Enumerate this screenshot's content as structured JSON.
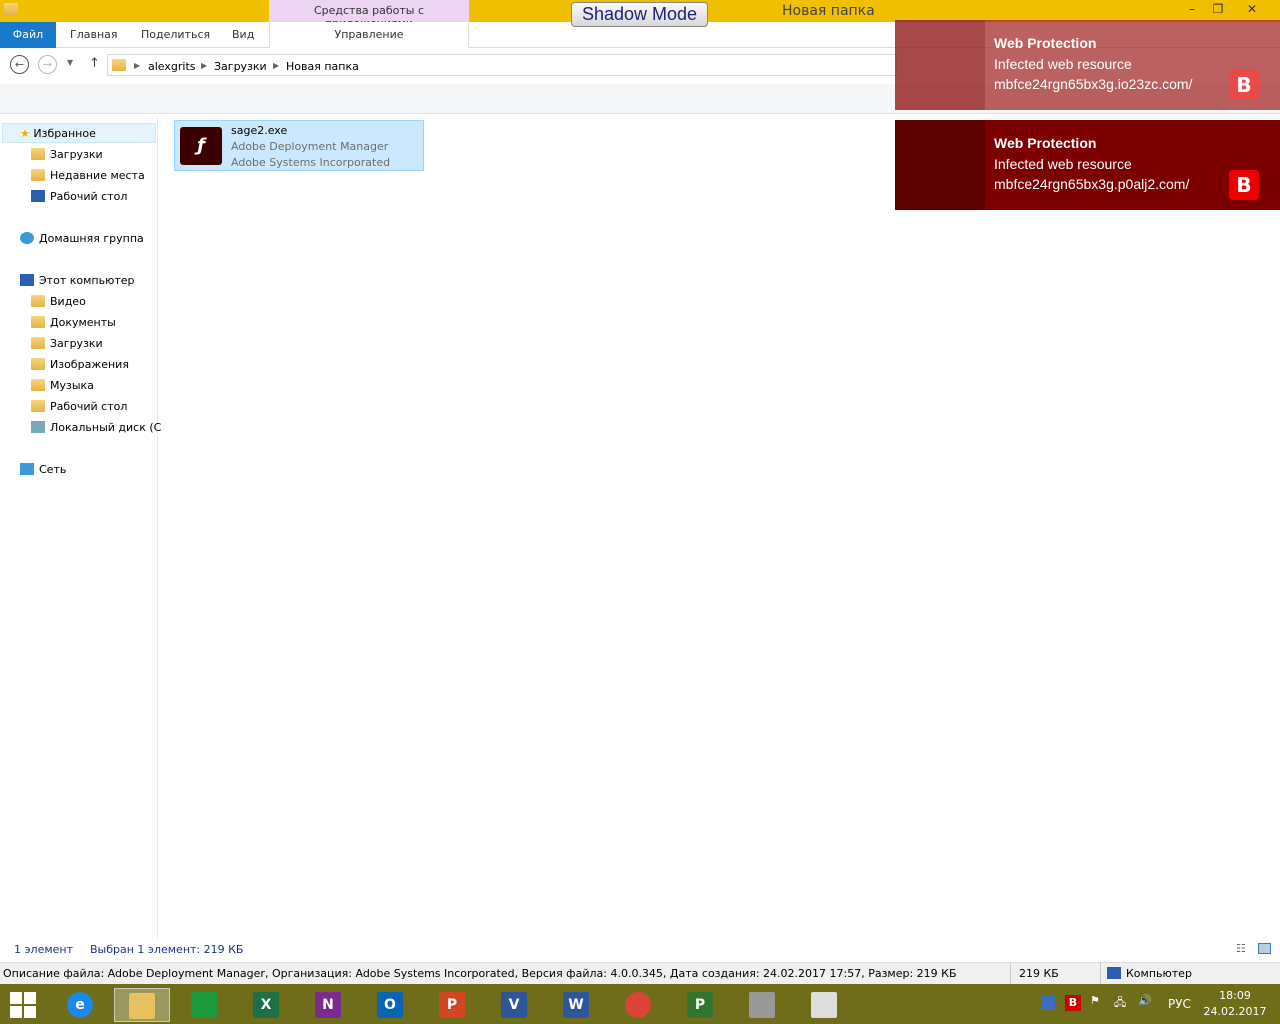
{
  "window": {
    "title": "Новая папка",
    "context_group": "Средства работы с приложениями",
    "context_tab": "Управление",
    "shadow_mode": "Shadow Mode"
  },
  "ribbon": {
    "tabs": [
      "Файл",
      "Главная",
      "Поделиться",
      "Вид"
    ]
  },
  "address": {
    "crumbs": [
      "alexgrits",
      "Загрузки",
      "Новая папка"
    ]
  },
  "nav": {
    "favorites": "Избранное",
    "fav_items": [
      "Загрузки",
      "Недавние места",
      "Рабочий стол"
    ],
    "homegroup": "Домашняя группа",
    "computer": "Этот компьютер",
    "pc_items": [
      "Видео",
      "Документы",
      "Загрузки",
      "Изображения",
      "Музыка",
      "Рабочий стол",
      "Локальный диск (C"
    ],
    "network": "Сеть"
  },
  "file": {
    "name": "sage2.exe",
    "desc": "Adobe Deployment Manager",
    "company": "Adobe Systems Incorporated",
    "icon": "flash-icon"
  },
  "status": {
    "count": "1 элемент",
    "selected": "Выбран 1 элемент: 219 КБ"
  },
  "details": {
    "text": "Описание файла: Adobe Deployment Manager, Организация: Adobe Systems Incorporated, Версия файла: 4.0.0.345, Дата создания: 24.02.2017 17:57, Размер: 219 КБ",
    "size": "219 КБ",
    "location": "Компьютер"
  },
  "toasts": [
    {
      "title": "Web Protection",
      "line1": "Infected web resource",
      "line2": "mbfce24rgn65bx3g.io23zc.com/",
      "logo": "B"
    },
    {
      "title": "Web Protection",
      "line1": "Infected web resource",
      "line2": "mbfce24rgn65bx3g.p0alj2.com/",
      "logo": "B"
    }
  ],
  "taskbar": {
    "apps": [
      {
        "n": "ie",
        "l": "e",
        "c": "#1e88e5"
      },
      {
        "n": "explorer",
        "l": "",
        "c": "#e8c060"
      },
      {
        "n": "store",
        "l": "",
        "c": "#1a9b3c"
      },
      {
        "n": "excel",
        "l": "X",
        "c": "#1d7044"
      },
      {
        "n": "onenote",
        "l": "N",
        "c": "#7b2b8f"
      },
      {
        "n": "outlook",
        "l": "O",
        "c": "#0a64b4"
      },
      {
        "n": "powerpoint",
        "l": "P",
        "c": "#d24625"
      },
      {
        "n": "visio",
        "l": "V",
        "c": "#2b579a"
      },
      {
        "n": "word",
        "l": "W",
        "c": "#2b579a"
      },
      {
        "n": "chrome",
        "l": "",
        "c": "#db4437"
      },
      {
        "n": "project",
        "l": "P",
        "c": "#31752f"
      },
      {
        "n": "wall",
        "l": "",
        "c": "#999"
      },
      {
        "n": "paint",
        "l": "",
        "c": "#ddd"
      }
    ],
    "lang": "РУС",
    "time": "18:09",
    "date": "24.02.2017",
    "tray_b": "B"
  }
}
